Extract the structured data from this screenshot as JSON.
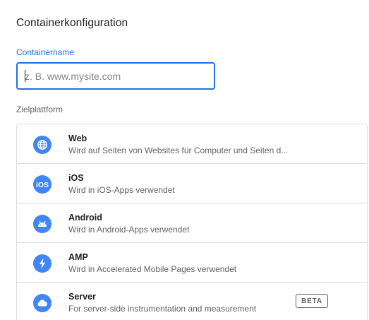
{
  "title": "Containerkonfiguration",
  "container_name": {
    "label": "Containername",
    "placeholder": "z. B. www.mysite.com",
    "value": ""
  },
  "platform_section": {
    "label": "Zielplattform",
    "items": [
      {
        "name": "Web",
        "description": "Wird auf Seiten von Websites für Computer und Seiten d...",
        "icon": "globe-icon"
      },
      {
        "name": "iOS",
        "description": "Wird in iOS-Apps verwendet",
        "icon": "ios-icon"
      },
      {
        "name": "Android",
        "description": "Wird in Android-Apps verwendet",
        "icon": "android-icon"
      },
      {
        "name": "AMP",
        "description": "Wird in Accelerated Mobile Pages verwendet",
        "icon": "lightning-bolt-icon"
      },
      {
        "name": "Server",
        "description": "For server-side instrumentation and measurement",
        "icon": "cloud-icon",
        "badge": "BETA"
      }
    ]
  },
  "colors": {
    "accent": "#1a73e8",
    "icon_background": "#4285f4",
    "border": "#dadce0"
  }
}
